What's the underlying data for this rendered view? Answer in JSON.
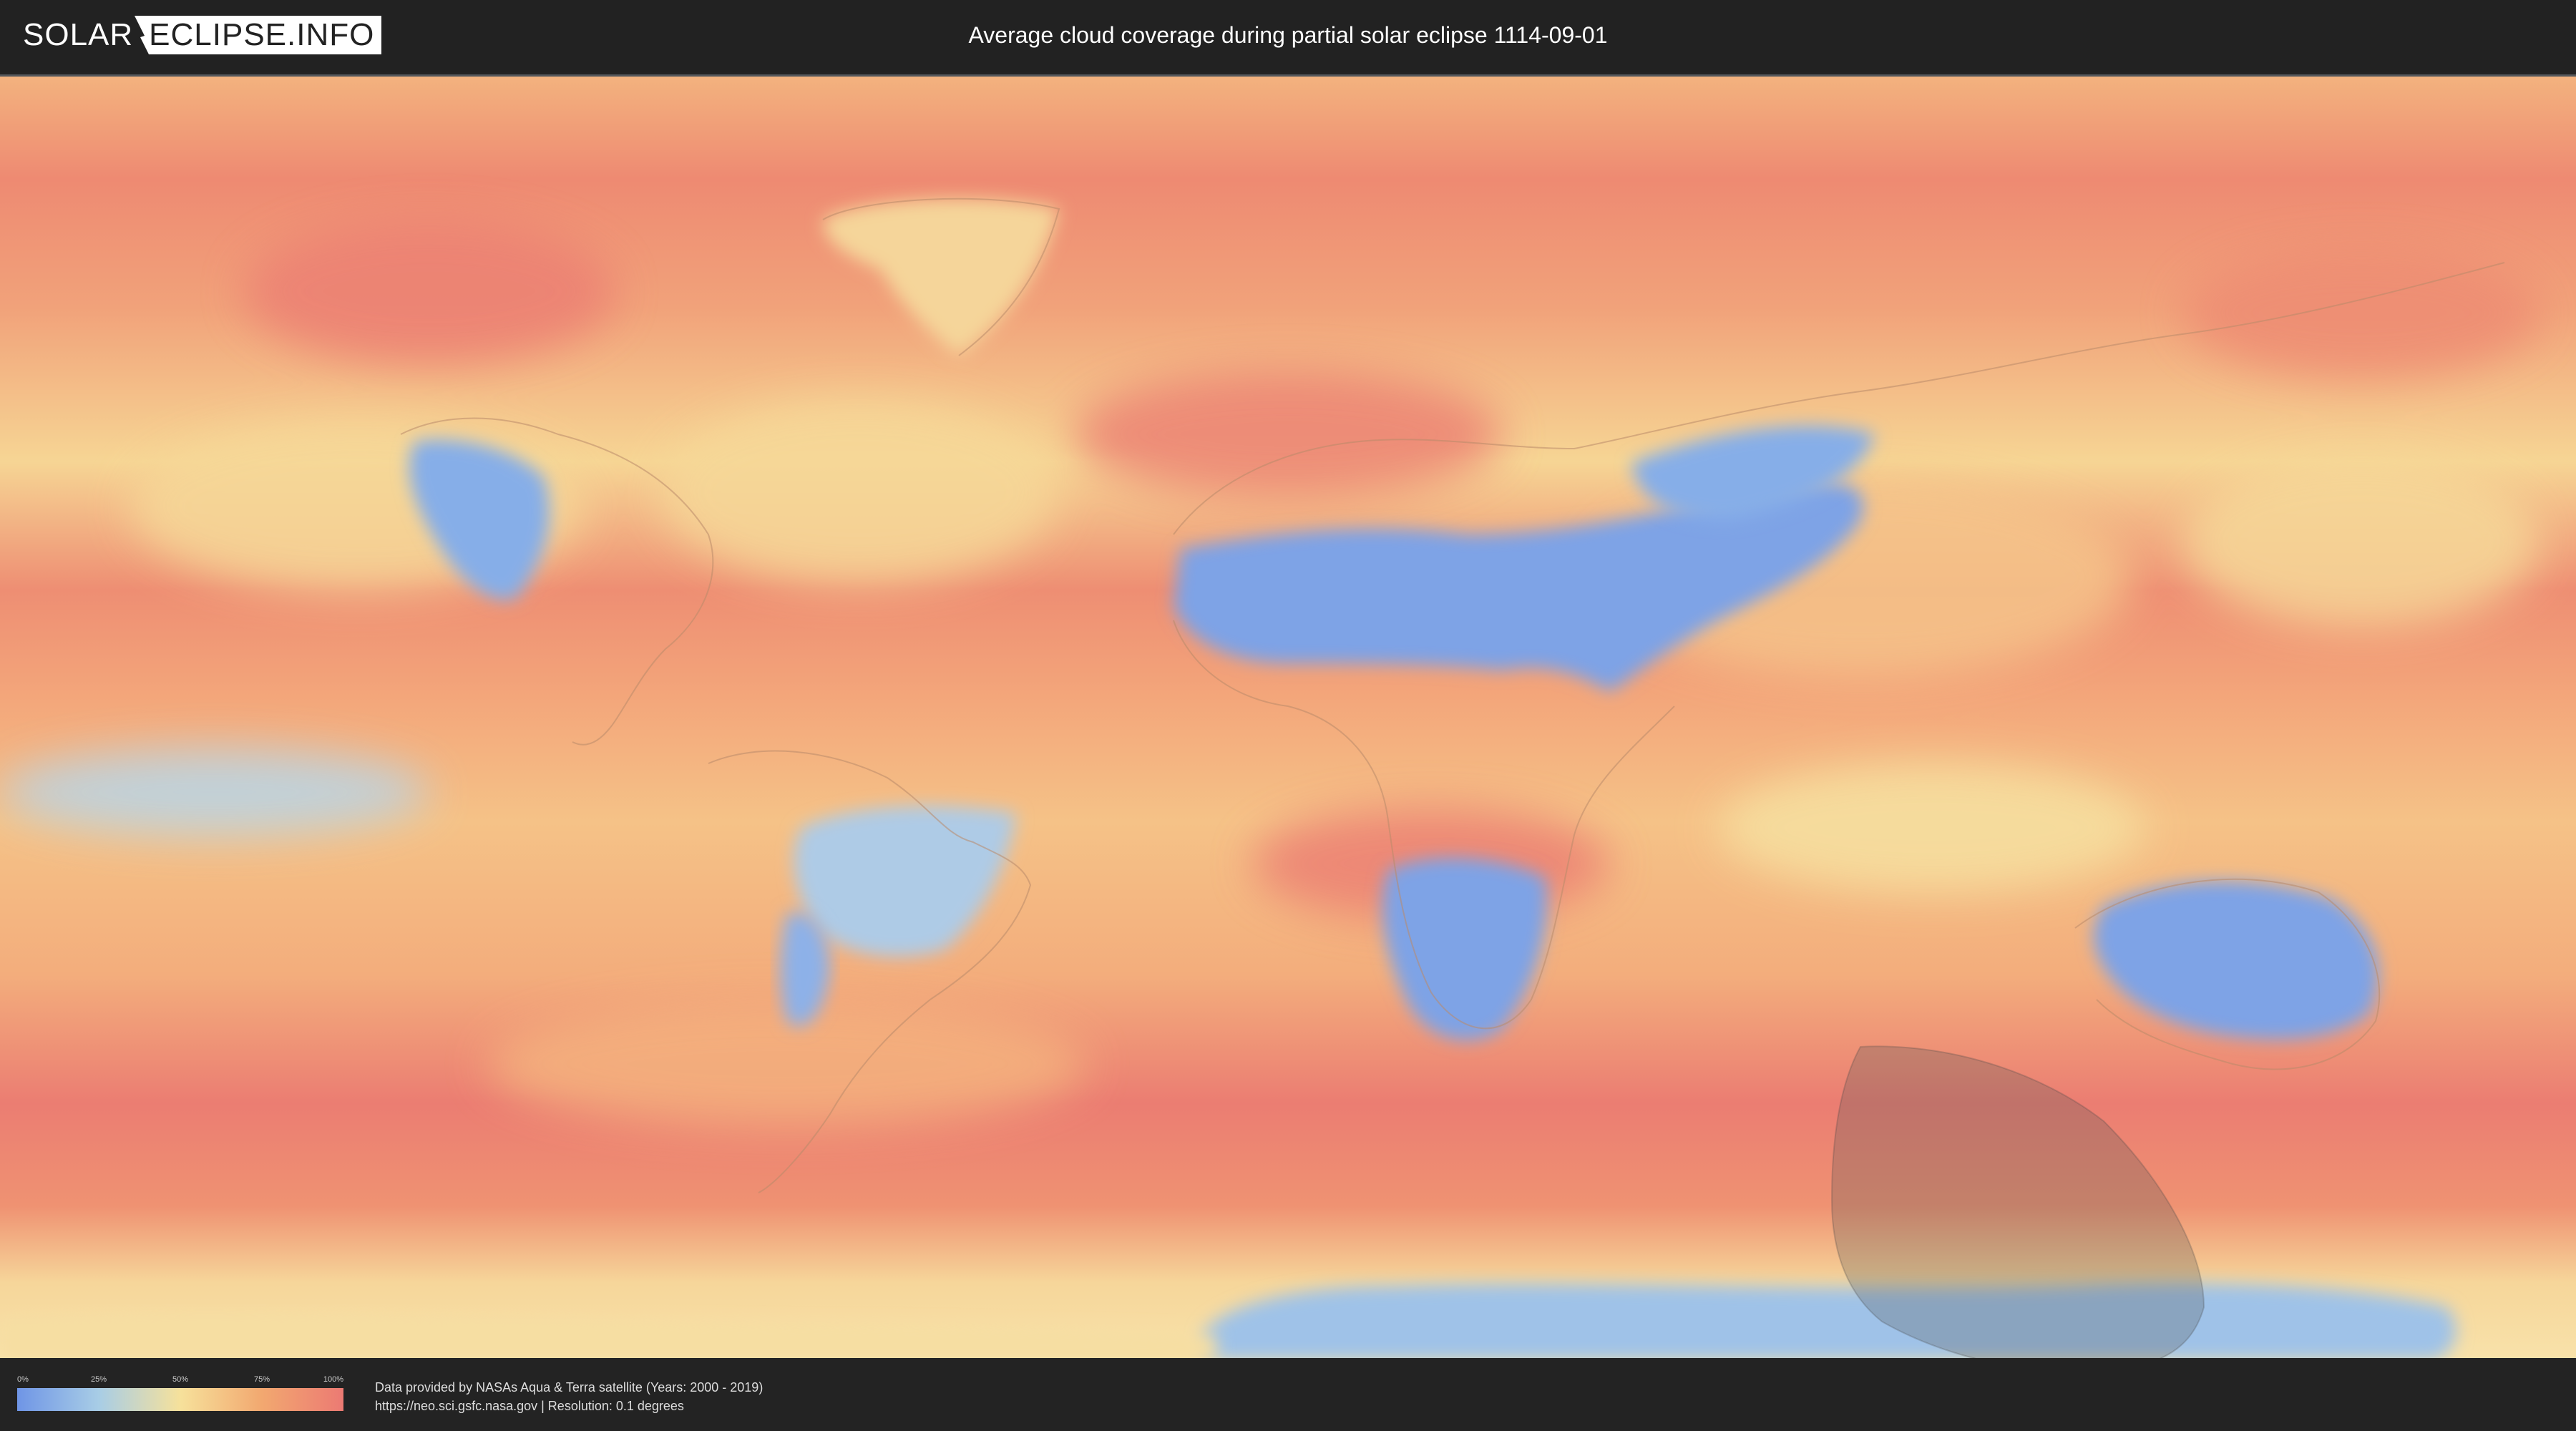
{
  "header": {
    "logo_left": "SOLAR",
    "logo_right": "ECLIPSE.INFO",
    "title": "Average cloud coverage during partial solar eclipse 1114-09-01"
  },
  "map": {
    "type": "cloud-coverage world map (equirectangular)",
    "eclipse_shadow_present": true
  },
  "legend": {
    "ticks": [
      "0%",
      "25%",
      "50%",
      "75%",
      "100%"
    ],
    "colors": [
      "#6f95e6",
      "#a8cde6",
      "#f6e19b",
      "#f2a870",
      "#ec7a73"
    ]
  },
  "credits": {
    "line1": "Data provided by NASAs Aqua & Terra satellite (Years: 2000 - 2019)",
    "line2": "https://neo.sci.gsfc.nasa.gov | Resolution: 0.1 degrees"
  }
}
